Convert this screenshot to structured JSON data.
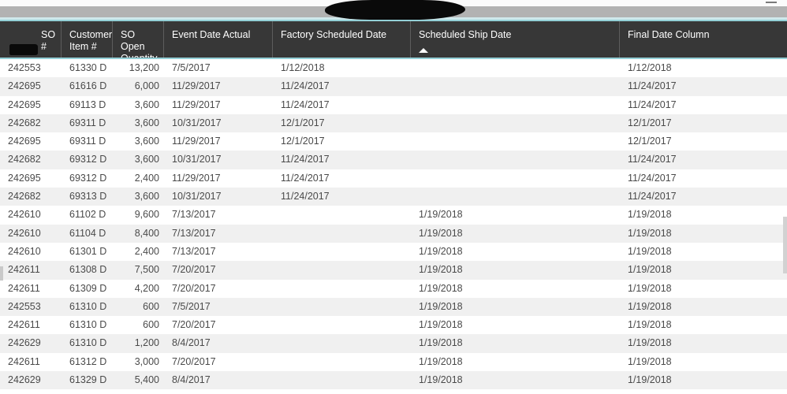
{
  "window": {
    "minimize_label": "—",
    "redaction_note": ""
  },
  "theme": {
    "header_background": "#373737",
    "header_accent_border": "#93cfd6",
    "header_text": "#ffffff",
    "row_text": "#4a4a4a",
    "row_alt_background": "#f0f0f0",
    "row_background": "#ffffff",
    "top_band": "#b2b2b2",
    "scrollbar_thumb": "#d2d2d2"
  },
  "table": {
    "sort": {
      "column": "Scheduled Ship Date",
      "direction": "ascending",
      "indicator": "▲"
    },
    "columns": [
      {
        "key": "so_number",
        "label": "SO #",
        "align": "left"
      },
      {
        "key": "customer_item_number",
        "label": "Customer Item #",
        "align": "left"
      },
      {
        "key": "so_open_quantity",
        "label": "SO Open Quantity",
        "align": "right"
      },
      {
        "key": "event_date_actual",
        "label": "Event Date Actual",
        "align": "left"
      },
      {
        "key": "factory_scheduled_date",
        "label": "Factory Scheduled Date",
        "align": "left"
      },
      {
        "key": "scheduled_ship_date",
        "label": "Scheduled Ship Date",
        "align": "left"
      },
      {
        "key": "final_date_column",
        "label": "Final Date Column",
        "align": "left"
      }
    ],
    "rows": [
      {
        "so_number": "242553",
        "customer_item_number": "61330 D",
        "so_open_quantity": "13,200",
        "event_date_actual": "7/5/2017",
        "factory_scheduled_date": "1/12/2018",
        "scheduled_ship_date": "",
        "final_date_column": "1/12/2018"
      },
      {
        "so_number": "242695",
        "customer_item_number": "61616 D",
        "so_open_quantity": "6,000",
        "event_date_actual": "11/29/2017",
        "factory_scheduled_date": "11/24/2017",
        "scheduled_ship_date": "",
        "final_date_column": "11/24/2017"
      },
      {
        "so_number": "242695",
        "customer_item_number": "69113 D",
        "so_open_quantity": "3,600",
        "event_date_actual": "11/29/2017",
        "factory_scheduled_date": "11/24/2017",
        "scheduled_ship_date": "",
        "final_date_column": "11/24/2017"
      },
      {
        "so_number": "242682",
        "customer_item_number": "69311 D",
        "so_open_quantity": "3,600",
        "event_date_actual": "10/31/2017",
        "factory_scheduled_date": "12/1/2017",
        "scheduled_ship_date": "",
        "final_date_column": "12/1/2017"
      },
      {
        "so_number": "242695",
        "customer_item_number": "69311 D",
        "so_open_quantity": "3,600",
        "event_date_actual": "11/29/2017",
        "factory_scheduled_date": "12/1/2017",
        "scheduled_ship_date": "",
        "final_date_column": "12/1/2017"
      },
      {
        "so_number": "242682",
        "customer_item_number": "69312 D",
        "so_open_quantity": "3,600",
        "event_date_actual": "10/31/2017",
        "factory_scheduled_date": "11/24/2017",
        "scheduled_ship_date": "",
        "final_date_column": "11/24/2017"
      },
      {
        "so_number": "242695",
        "customer_item_number": "69312 D",
        "so_open_quantity": "2,400",
        "event_date_actual": "11/29/2017",
        "factory_scheduled_date": "11/24/2017",
        "scheduled_ship_date": "",
        "final_date_column": "11/24/2017"
      },
      {
        "so_number": "242682",
        "customer_item_number": "69313 D",
        "so_open_quantity": "3,600",
        "event_date_actual": "10/31/2017",
        "factory_scheduled_date": "11/24/2017",
        "scheduled_ship_date": "",
        "final_date_column": "11/24/2017"
      },
      {
        "so_number": "242610",
        "customer_item_number": "61102 D",
        "so_open_quantity": "9,600",
        "event_date_actual": "7/13/2017",
        "factory_scheduled_date": "",
        "scheduled_ship_date": "1/19/2018",
        "final_date_column": "1/19/2018"
      },
      {
        "so_number": "242610",
        "customer_item_number": "61104 D",
        "so_open_quantity": "8,400",
        "event_date_actual": "7/13/2017",
        "factory_scheduled_date": "",
        "scheduled_ship_date": "1/19/2018",
        "final_date_column": "1/19/2018"
      },
      {
        "so_number": "242610",
        "customer_item_number": "61301 D",
        "so_open_quantity": "2,400",
        "event_date_actual": "7/13/2017",
        "factory_scheduled_date": "",
        "scheduled_ship_date": "1/19/2018",
        "final_date_column": "1/19/2018"
      },
      {
        "so_number": "242611",
        "customer_item_number": "61308 D",
        "so_open_quantity": "7,500",
        "event_date_actual": "7/20/2017",
        "factory_scheduled_date": "",
        "scheduled_ship_date": "1/19/2018",
        "final_date_column": "1/19/2018"
      },
      {
        "so_number": "242611",
        "customer_item_number": "61309 D",
        "so_open_quantity": "4,200",
        "event_date_actual": "7/20/2017",
        "factory_scheduled_date": "",
        "scheduled_ship_date": "1/19/2018",
        "final_date_column": "1/19/2018"
      },
      {
        "so_number": "242553",
        "customer_item_number": "61310 D",
        "so_open_quantity": "600",
        "event_date_actual": "7/5/2017",
        "factory_scheduled_date": "",
        "scheduled_ship_date": "1/19/2018",
        "final_date_column": "1/19/2018"
      },
      {
        "so_number": "242611",
        "customer_item_number": "61310 D",
        "so_open_quantity": "600",
        "event_date_actual": "7/20/2017",
        "factory_scheduled_date": "",
        "scheduled_ship_date": "1/19/2018",
        "final_date_column": "1/19/2018"
      },
      {
        "so_number": "242629",
        "customer_item_number": "61310 D",
        "so_open_quantity": "1,200",
        "event_date_actual": "8/4/2017",
        "factory_scheduled_date": "",
        "scheduled_ship_date": "1/19/2018",
        "final_date_column": "1/19/2018"
      },
      {
        "so_number": "242611",
        "customer_item_number": "61312 D",
        "so_open_quantity": "3,000",
        "event_date_actual": "7/20/2017",
        "factory_scheduled_date": "",
        "scheduled_ship_date": "1/19/2018",
        "final_date_column": "1/19/2018"
      },
      {
        "so_number": "242629",
        "customer_item_number": "61329 D",
        "so_open_quantity": "5,400",
        "event_date_actual": "8/4/2017",
        "factory_scheduled_date": "",
        "scheduled_ship_date": "1/19/2018",
        "final_date_column": "1/19/2018"
      }
    ]
  }
}
